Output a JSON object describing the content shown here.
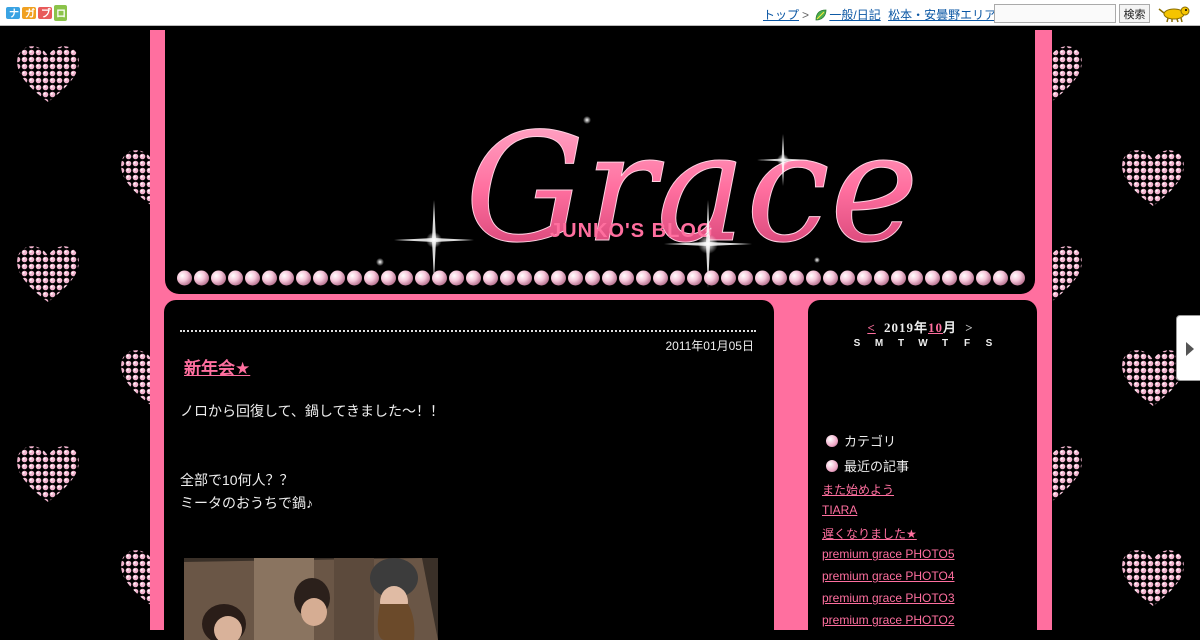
{
  "topbar": {
    "logo_text": "ナガブロ",
    "breadcrumb_top": "トップ",
    "breadcrumb_sep": ">",
    "category_link": "一般/日記",
    "area_link": "松本・安曇野エリア",
    "search_placeholder": "",
    "search_button": "検索"
  },
  "header": {
    "title": "Grace",
    "subtitle": "JUNKO'S BLOG"
  },
  "post": {
    "date": "2011年01月05日",
    "title": "新年会★",
    "lines": [
      "ノロから回復して、鍋してきました～！！",
      "全部で10何人？？",
      "ミータのおうちで鍋♪"
    ]
  },
  "calendar": {
    "prev": "<",
    "year": "2019年",
    "month": "10",
    "month_suffix": "月",
    "next": ">",
    "weekdays": [
      "S",
      "M",
      "T",
      "W",
      "T",
      "F",
      "S"
    ]
  },
  "sidebar": {
    "category_heading": "カテゴリ",
    "recent_heading": "最近の記事",
    "recent_links": [
      "また始めよう",
      "TIARA",
      "遅くなりました★",
      "premium grace PHOTO5",
      "premium grace PHOTO4",
      "premium grace PHOTO3",
      "premium grace PHOTO2"
    ]
  },
  "colors": {
    "accent_pink": "#ff6f9f",
    "background": "#000000",
    "link_blue": "#0b57a4"
  },
  "icons": [
    "heart-icon",
    "leaf-icon",
    "mascot-icon",
    "gem-icon",
    "chevron-right-icon"
  ]
}
